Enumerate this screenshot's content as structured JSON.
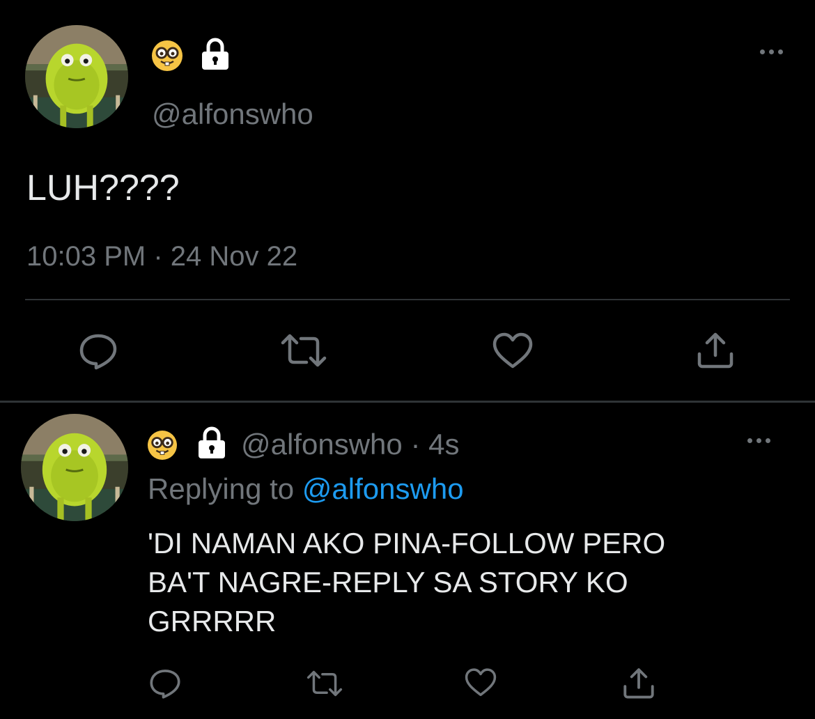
{
  "main_tweet": {
    "handle": "@alfonswho",
    "text": "LUH????",
    "time": "10:03 PM",
    "date": "24 Nov 22",
    "meta_separator": "·",
    "icons": {
      "more": "more-options-icon",
      "reply": "reply-icon",
      "retweet": "retweet-icon",
      "like": "heart-icon",
      "share": "share-icon",
      "badge_emoji": "nerd-face-emoji",
      "protected": "lock-icon"
    }
  },
  "reply_tweet": {
    "handle": "@alfonswho",
    "separator": "·",
    "age": "4s",
    "replying_prefix": "Replying to",
    "replying_mention": "@alfonswho",
    "text_lines": [
      "'DI NAMAN AKO PINA-FOLLOW PERO",
      "BA'T NAGRE-REPLY SA STORY KO",
      "GRRRRR"
    ]
  },
  "colors": {
    "background": "#000000",
    "primary_text": "#e7e9ea",
    "secondary_text": "#71767b",
    "link": "#1d9bf0",
    "divider": "#2f3336"
  }
}
